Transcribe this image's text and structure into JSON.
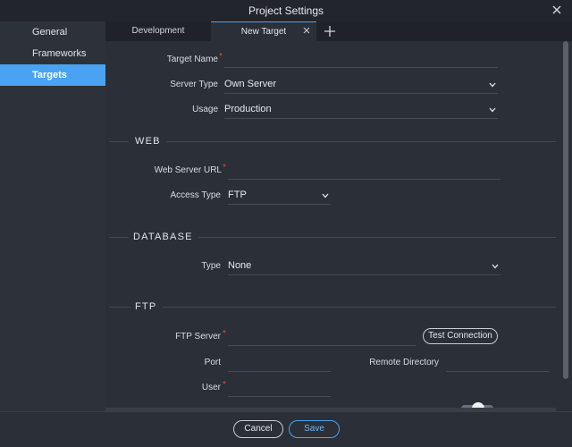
{
  "window": {
    "title": "Project Settings"
  },
  "sidebar": {
    "items": [
      {
        "label": "General"
      },
      {
        "label": "Frameworks"
      },
      {
        "label": "Targets"
      }
    ]
  },
  "tabs": [
    {
      "label": "Development"
    },
    {
      "label": "New Target"
    }
  ],
  "form": {
    "target_name": {
      "label": "Target Name",
      "required": "*",
      "value": ""
    },
    "server_type": {
      "label": "Server Type",
      "value": "Own Server"
    },
    "usage": {
      "label": "Usage",
      "value": "Production"
    }
  },
  "sections": {
    "web": {
      "title": "WEB",
      "web_server_url": {
        "label": "Web Server URL",
        "required": "*",
        "value": ""
      },
      "access_type": {
        "label": "Access Type",
        "value": "FTP"
      }
    },
    "database": {
      "title": "DATABASE",
      "type": {
        "label": "Type",
        "value": "None"
      }
    },
    "ftp": {
      "title": "FTP",
      "ftp_server": {
        "label": "FTP Server",
        "required": "*",
        "value": ""
      },
      "test_connection": "Test Connection",
      "port": {
        "label": "Port",
        "value": ""
      },
      "remote_directory": {
        "label": "Remote Directory",
        "value": ""
      },
      "user": {
        "label": "User",
        "required": "*",
        "value": ""
      }
    }
  },
  "footer": {
    "cancel": "Cancel",
    "save": "Save"
  },
  "colors": {
    "accent": "#4aa3f2",
    "required": "#e04a4a"
  }
}
